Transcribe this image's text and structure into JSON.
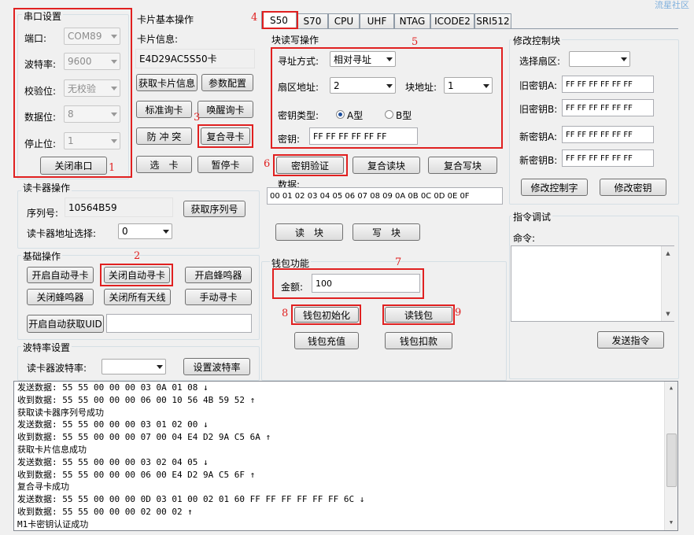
{
  "watermark": "流星社区",
  "serial": {
    "title": "串口设置",
    "port_label": "端口:",
    "port_value": "COM89",
    "baud_label": "波特率:",
    "baud_value": "9600",
    "parity_label": "校验位:",
    "parity_value": "无校验",
    "databits_label": "数据位:",
    "databits_value": "8",
    "stopbits_label": "停止位:",
    "stopbits_value": "1",
    "close_btn": "关闭串口"
  },
  "card_basic": {
    "title": "卡片基本操作",
    "info_label": "卡片信息:",
    "info_value": "E4D29AC5S50卡",
    "btn_get_info": "获取卡片信息",
    "btn_param": "参数配置",
    "btn_std_find": "标准询卡",
    "btn_wake_find": "唤醒询卡",
    "btn_anticoll": "防 冲 突",
    "btn_combo_find": "复合寻卡",
    "btn_select": "选　卡",
    "btn_halt": "暂停卡"
  },
  "tabs": [
    "S50",
    "S70",
    "CPU",
    "UHF",
    "NTAG",
    "ICODE2",
    "SRI512"
  ],
  "block_rw": {
    "title": "块读写操作",
    "addr_mode_label": "寻址方式:",
    "addr_mode_value": "相对寻址",
    "sector_label": "扇区地址:",
    "sector_value": "2",
    "block_label": "块地址:",
    "block_value": "1",
    "keytype_label": "密钥类型:",
    "key_a": "A型",
    "key_b": "B型",
    "key_label": "密钥:",
    "key_value": "FF FF FF FF FF FF",
    "btn_auth": "密钥验证",
    "btn_combo_read": "复合读块",
    "btn_combo_write": "复合写块",
    "data_label": "数据:",
    "data_value": "00 01 02 03 04 05 06 07 08 09 0A 0B 0C 0D 0E 0F",
    "btn_read": "读　块",
    "btn_write": "写　块"
  },
  "ctrl_block": {
    "title": "修改控制块",
    "sector_label": "选择扇区:",
    "sector_value": "",
    "old_a_label": "旧密钥A:",
    "old_a_value": "FF FF FF FF FF FF",
    "old_b_label": "旧密钥B:",
    "old_b_value": "FF FF FF FF FF FF",
    "new_a_label": "新密钥A:",
    "new_a_value": "FF FF FF FF FF FF",
    "new_b_label": "新密钥B:",
    "new_b_value": "FF FF FF FF FF FF",
    "btn_modify_ctrl": "修改控制字",
    "btn_modify_key": "修改密钥"
  },
  "reader": {
    "title": "读卡器操作",
    "serial_label": "序列号:",
    "serial_value": "10564B59",
    "btn_get_serial": "获取序列号",
    "addr_label": "读卡器地址选择:",
    "addr_value": "0"
  },
  "basic_ops": {
    "title": "基础操作",
    "btn_auto_on": "开启自动寻卡",
    "btn_auto_off": "关闭自动寻卡",
    "btn_buzzer_on": "开启蜂鸣器",
    "btn_buzzer_off": "关闭蜂鸣器",
    "btn_antenna_off": "关闭所有天线",
    "btn_manual": "手动寻卡",
    "btn_auto_uid": "开启自动获取UID",
    "uid_value": ""
  },
  "baud": {
    "title": "波特率设置",
    "label": "读卡器波特率:",
    "value": "",
    "btn_set": "设置波特率"
  },
  "wallet": {
    "title": "钱包功能",
    "amount_label": "金额:",
    "amount_value": "100",
    "btn_init": "钱包初始化",
    "btn_read": "读钱包",
    "btn_charge": "钱包充值",
    "btn_deduct": "钱包扣款"
  },
  "cmd": {
    "title": "指令调试",
    "label": "命令:",
    "value": "",
    "btn_send": "发送指令"
  },
  "annotations": [
    "1",
    "2",
    "3",
    "4",
    "5",
    "6",
    "7",
    "8",
    "9"
  ],
  "log": [
    "发送数据: 55 55 00 00 00 03 0A 01 08 ↓",
    "收到数据: 55 55 00 00 00 06 00 10 56 4B 59 52 ↑",
    "获取读卡器序列号成功",
    "发送数据: 55 55 00 00 00 03 01 02 00 ↓",
    "收到数据: 55 55 00 00 00 07 00 04 E4 D2 9A C5 6A ↑",
    "获取卡片信息成功",
    "发送数据: 55 55 00 00 00 03 02 04 05 ↓",
    "收到数据: 55 55 00 00 00 06 00 E4 D2 9A C5 6F ↑",
    "复合寻卡成功",
    "发送数据: 55 55 00 00 00 0D 03 01 00 02 01 60 FF FF FF FF FF FF 6C ↓",
    "收到数据: 55 55 00 00 00 02 00 02 ↑",
    "M1卡密钥认证成功"
  ]
}
